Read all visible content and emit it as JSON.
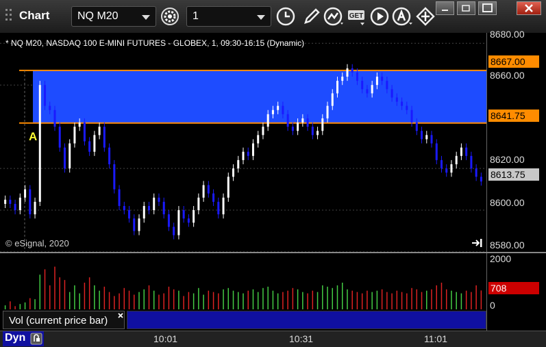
{
  "window": {
    "title": "Chart",
    "minimize_icon": "minimize-window-icon",
    "restore_icon": "restore-window-icon",
    "maximize_icon": "maximize-window-icon",
    "close_icon": "close-icon"
  },
  "toolbar": {
    "symbol": "NQ M20",
    "interval": "1",
    "icons": [
      "settings-gear-icon",
      "clock-icon",
      "pencil-draw-icon",
      "study-lines-icon",
      "get-icon",
      "play-icon",
      "alert-icon",
      "diamond-arrows-icon"
    ],
    "get_label": "GET"
  },
  "chart": {
    "description": "* NQ M20, NASDAQ 100 E-MINI FUTURES - GLOBEX, 1, 09:30-16:15 (Dynamic)",
    "copyright": "© eSignal, 2020",
    "annotation_letter": "A",
    "price_ticks": [
      "8680.00",
      "8660.00",
      "8620.00",
      "8600.00",
      "8580.00"
    ],
    "upper_line_label": "8667.00",
    "lower_line_label": "8641.75",
    "last_price": "8613.75",
    "time_labels": [
      "10:01",
      "10:31",
      "11:01"
    ],
    "zone_color": "#1e4cff",
    "line_color": "#ff8c00",
    "up_color": "#ffffff",
    "down_color": "#1a1aff"
  },
  "volume": {
    "ticks": [
      "2000",
      "708",
      "0"
    ],
    "last_volume": "708",
    "study_label": "Vol (current price bar)",
    "up_color": "#44cc44",
    "down_color": "#dd2222",
    "last_color": "#cc0000"
  },
  "bottom": {
    "label": "Dyn",
    "icon": "link-icon"
  },
  "chart_data": {
    "type": "candlestick",
    "symbol": "NQ M20",
    "ylim": [
      8580,
      8685
    ],
    "horizontal_lines": [
      8667.0,
      8641.75
    ],
    "volume_ylim": [
      0,
      2000
    ],
    "last_price": 8613.75,
    "last_volume": 708,
    "closes": [
      8605,
      8603,
      8600,
      8606,
      8610,
      8598,
      8604,
      8660,
      8650,
      8648,
      8640,
      8630,
      8620,
      8632,
      8640,
      8642,
      8633,
      8628,
      8636,
      8640,
      8630,
      8622,
      8610,
      8602,
      8600,
      8596,
      8590,
      8596,
      8602,
      8600,
      8606,
      8604,
      8598,
      8592,
      8588,
      8600,
      8596,
      8594,
      8600,
      8606,
      8612,
      8608,
      8604,
      8598,
      8606,
      8616,
      8620,
      8624,
      8628,
      8626,
      8632,
      8636,
      8640,
      8646,
      8648,
      8650,
      8646,
      8640,
      8638,
      8642,
      8644,
      8640,
      8636,
      8638,
      8644,
      8650,
      8656,
      8662,
      8664,
      8668,
      8666,
      8662,
      8658,
      8656,
      8660,
      8664,
      8662,
      8658,
      8654,
      8652,
      8650,
      8648,
      8642,
      8638,
      8634,
      8636,
      8632,
      8624,
      8620,
      8618,
      8622,
      8626,
      8630,
      8626,
      8620,
      8616,
      8613.75
    ],
    "volumes": [
      150,
      300,
      120,
      200,
      260,
      420,
      380,
      1300,
      1500,
      900,
      1600,
      1200,
      1100,
      650,
      900,
      600,
      1000,
      1200,
      900,
      700,
      850,
      650,
      500,
      600,
      800,
      700,
      550,
      650,
      750,
      900,
      700,
      550,
      600,
      850,
      750,
      700,
      500,
      650,
      600,
      800,
      550,
      700,
      650,
      600,
      750,
      800,
      700,
      650,
      600,
      700,
      750,
      650,
      800,
      850,
      700,
      600,
      650,
      700,
      800,
      750,
      650,
      600,
      700,
      650,
      900,
      850,
      800,
      900,
      1000,
      750,
      700,
      650,
      600,
      700,
      650,
      700,
      750,
      650,
      600,
      700,
      650,
      600,
      800,
      750,
      650,
      700,
      750,
      900,
      1000,
      750,
      700,
      650,
      600,
      700,
      650,
      900,
      708
    ]
  }
}
